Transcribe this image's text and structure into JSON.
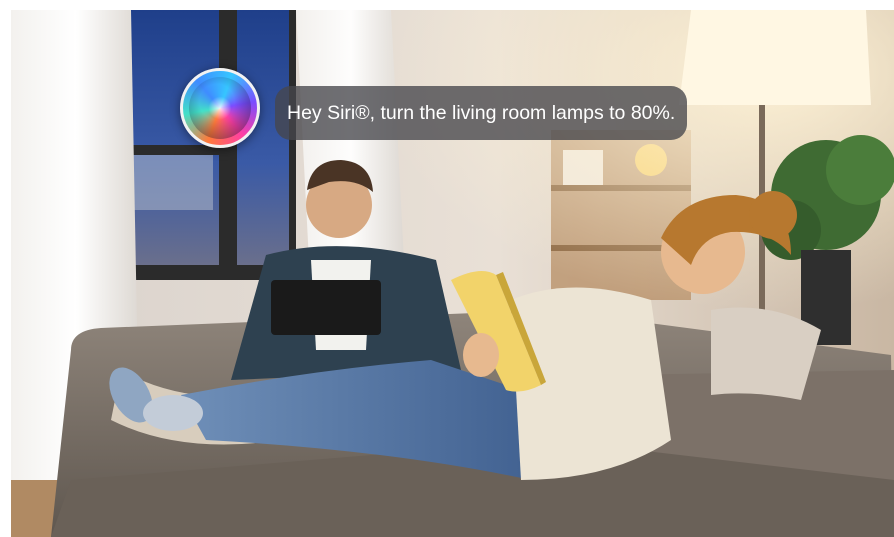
{
  "photo": {
    "description_icon": "living-room-photo"
  },
  "siri": {
    "icon": "siri-icon",
    "prompt": "Hey Siri®, turn the living room lamps to 80%."
  }
}
